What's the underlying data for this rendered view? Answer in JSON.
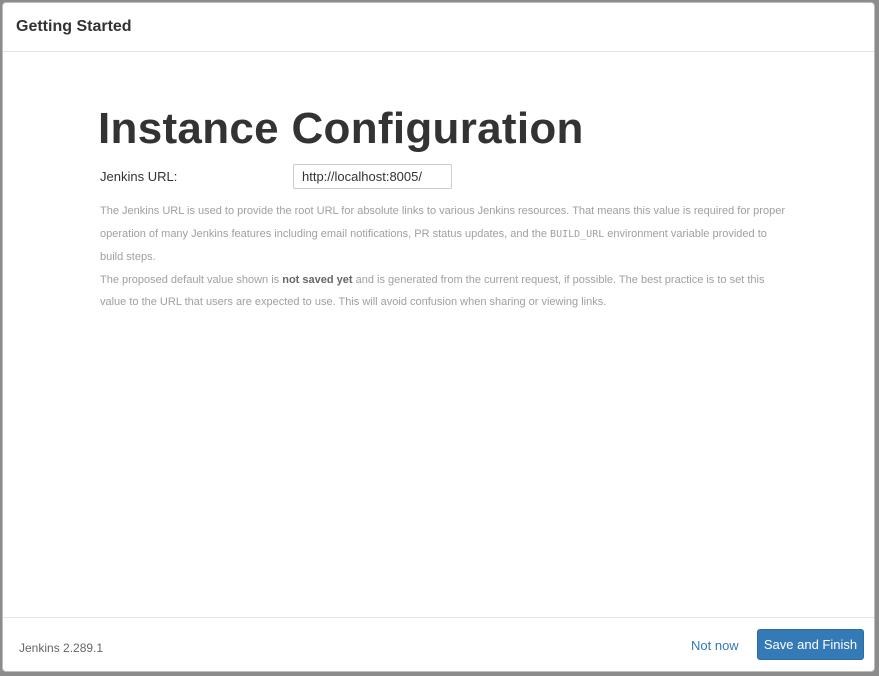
{
  "header": {
    "title": "Getting Started"
  },
  "main": {
    "heading": "Instance Configuration",
    "url_label": "Jenkins URL:",
    "url_value": "http://localhost:8005/",
    "help": {
      "p1_part1": "The Jenkins URL is used to provide the root URL for absolute links to various Jenkins resources. That means this value is required for proper operation of many Jenkins features including email notifications, PR status updates, and the ",
      "p1_code": "BUILD_URL",
      "p1_part2": " environment variable provided to build steps.",
      "p2_part1": "The proposed default value shown is ",
      "p2_bold": "not saved yet",
      "p2_part2": " and is generated from the current request, if possible. The best practice is to set this value to the URL that users are expected to use. This will avoid confusion when sharing or viewing links."
    }
  },
  "footer": {
    "version": "Jenkins 2.289.1",
    "not_now_label": "Not now",
    "save_label": "Save and Finish"
  },
  "colors": {
    "primary": "#337ab7",
    "help_text": "#a0a0a0"
  }
}
